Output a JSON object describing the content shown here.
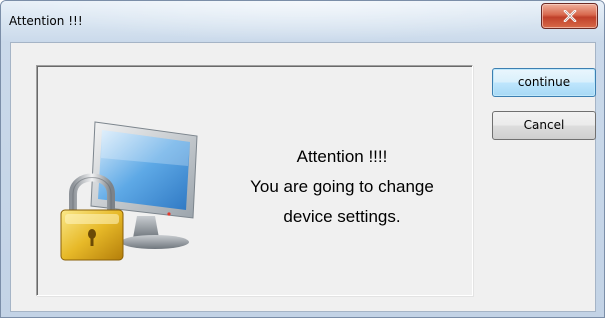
{
  "window": {
    "title": "Attention !!!",
    "close_icon": "close-icon"
  },
  "message": {
    "line1": "Attention !!!!",
    "line2": "You are going to change",
    "line3": "device settings."
  },
  "icon": {
    "name": "monitor-lock-icon"
  },
  "buttons": {
    "continue_label": "continue",
    "cancel_label": "Cancel"
  },
  "colors": {
    "close_button": "#c9472f",
    "default_button_border": "#3c7fb1",
    "dialog_background": "#f0f0f0"
  }
}
